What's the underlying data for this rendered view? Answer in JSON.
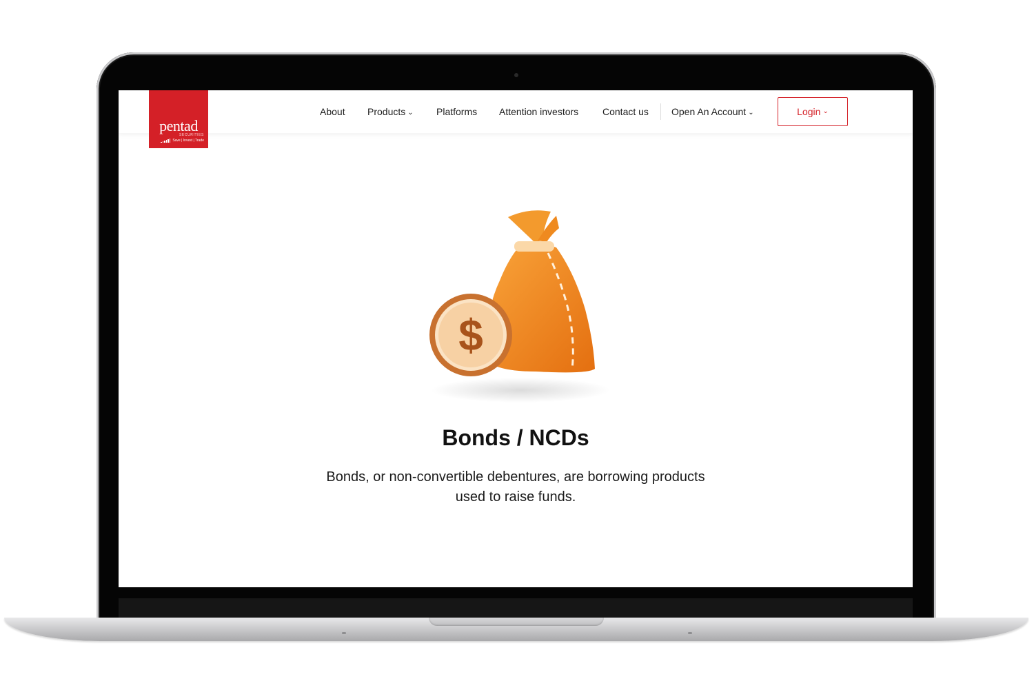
{
  "brand": {
    "name": "pentad",
    "sub": "SECURITIES",
    "tagline": "Save | Invest | Trade",
    "color": "#d42027"
  },
  "nav": {
    "items": [
      {
        "label": "About"
      },
      {
        "label": "Products",
        "dropdown": true
      },
      {
        "label": "Platforms"
      },
      {
        "label": "Attention investors"
      },
      {
        "label": "Contact us"
      },
      {
        "label": "Open An Account",
        "dropdown": true
      }
    ],
    "login_label": "Login"
  },
  "hero": {
    "icon": "money-bag-with-dollar-coin",
    "title": "Bonds / NCDs",
    "description": "Bonds, or non-convertible debentures, are borrowing products used to raise funds."
  },
  "colors": {
    "accent": "#d42027",
    "bag": "#f0891c",
    "coin": "#c8712f"
  }
}
